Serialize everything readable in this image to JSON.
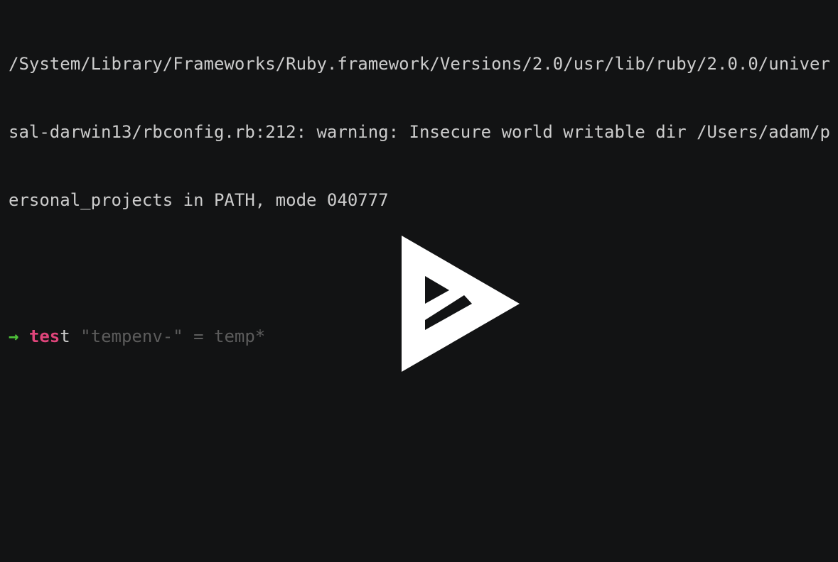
{
  "terminal": {
    "output_lines": [
      "/System/Library/Frameworks/Ruby.framework/Versions/2.0/usr/lib/ruby/2.0.0/univer",
      "sal-darwin13/rbconfig.rb:212: warning: Insecure world writable dir /Users/adam/p",
      "ersonal_projects in PATH, mode 040777"
    ],
    "prompt": {
      "arrow": "→",
      "typed": "tes",
      "rest": "t",
      "suggestion": " \"tempenv-\" = temp*"
    }
  },
  "player": {
    "icon": "asciinema-play-icon",
    "colors": {
      "background": "#121314",
      "logo": "#ffffff",
      "prompt_arrow": "#4ec33a",
      "typed_command": "#e0457b",
      "suggestion": "#5c5c5c"
    }
  }
}
